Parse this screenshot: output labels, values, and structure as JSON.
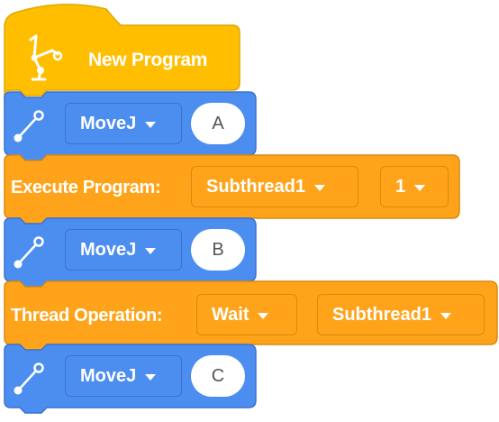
{
  "program": {
    "hat_label": "New Program",
    "blocks": [
      {
        "kind": "move",
        "mode": "MoveJ",
        "point": "A"
      },
      {
        "kind": "execute",
        "label": "Execute Program:",
        "program": "Subthread1",
        "count": "1"
      },
      {
        "kind": "move",
        "mode": "MoveJ",
        "point": "B"
      },
      {
        "kind": "thread",
        "label": "Thread Operation:",
        "operation": "Wait",
        "target": "Subthread1"
      },
      {
        "kind": "move",
        "mode": "MoveJ",
        "point": "C"
      }
    ]
  },
  "colors": {
    "hat": "#FFBF00",
    "motion": "#4C8EF0",
    "control": "#FFA41A"
  },
  "icons": {
    "hat": "robot-arm-icon",
    "move": "joint-link-icon"
  }
}
